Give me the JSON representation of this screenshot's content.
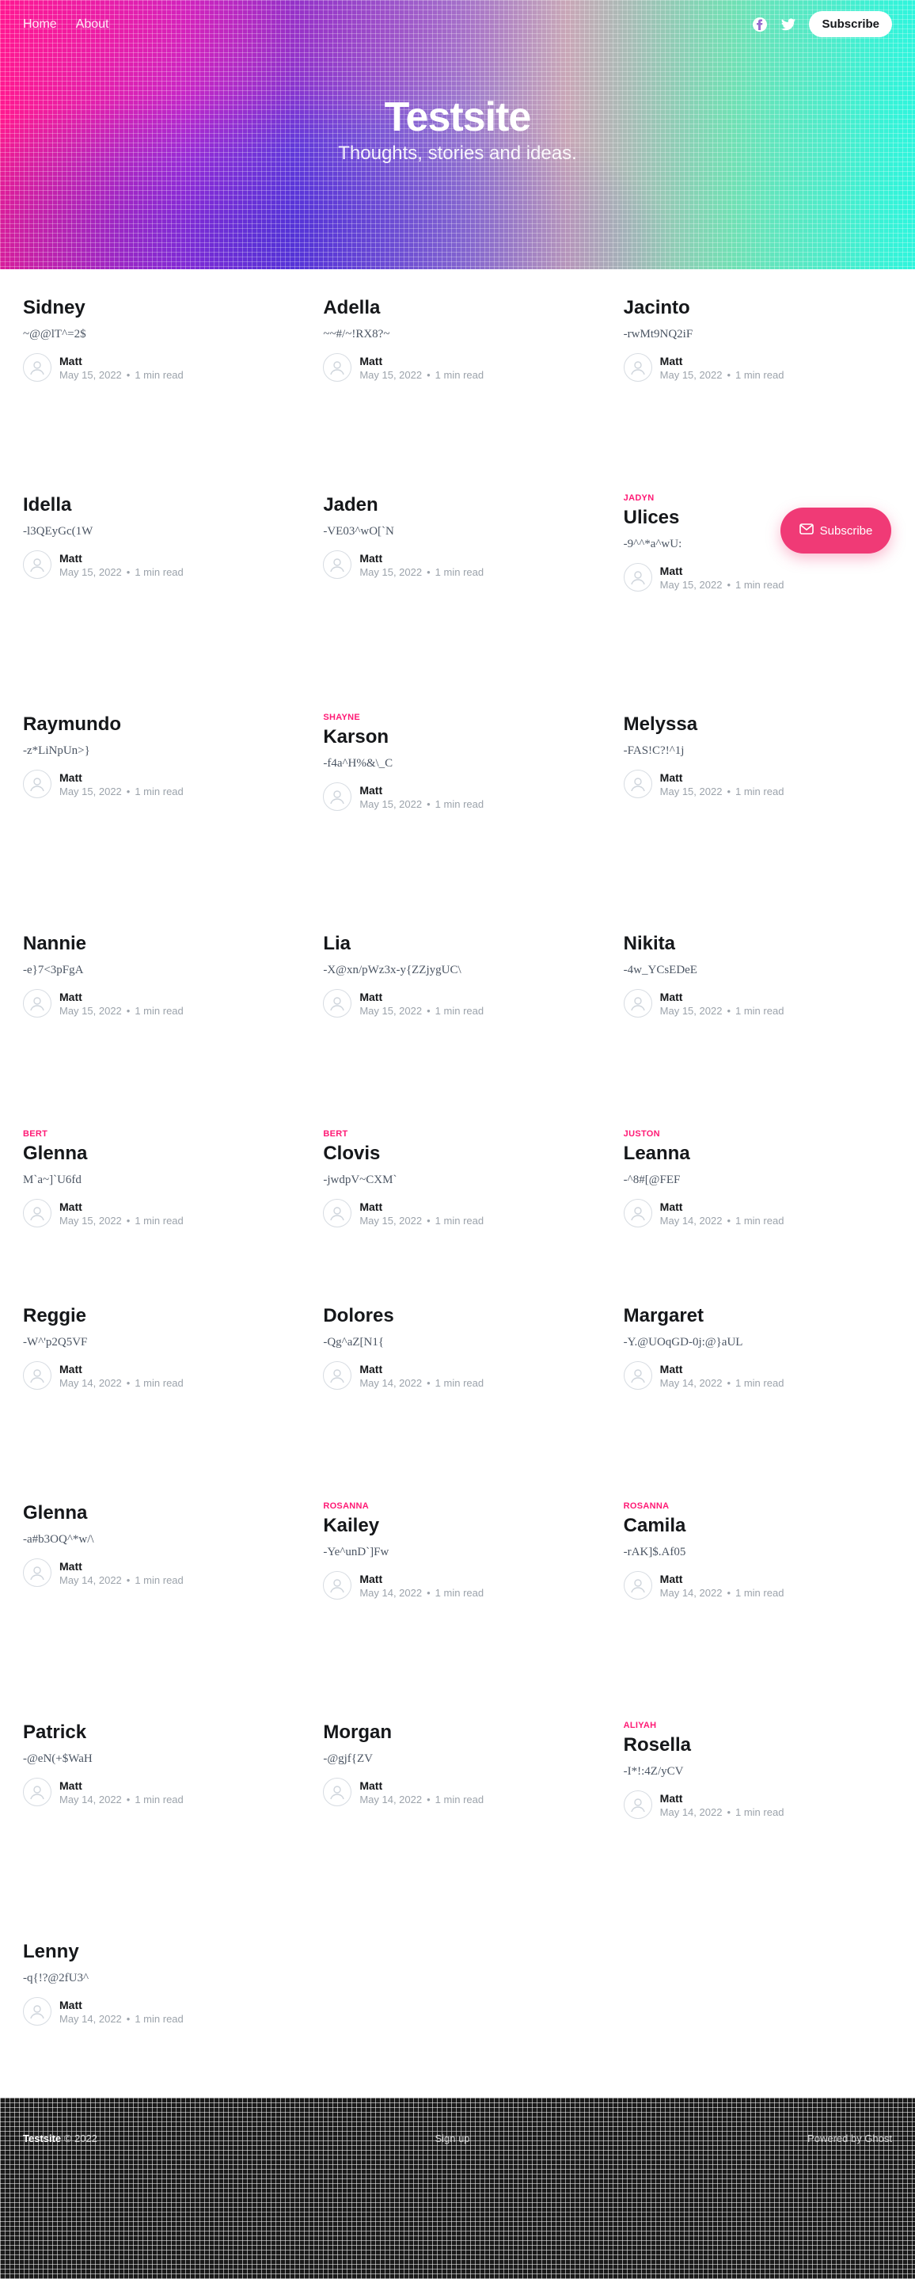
{
  "nav": {
    "links": [
      "Home",
      "About"
    ],
    "subscribe_label": "Subscribe"
  },
  "header": {
    "title": "Testsite",
    "description": "Thoughts, stories and ideas."
  },
  "posts": [
    {
      "tag": "",
      "title": "Sidney",
      "excerpt": "~@@lT^=2$",
      "author": "Matt",
      "date": "May 15, 2022",
      "read": "1 min read"
    },
    {
      "tag": "",
      "title": "Adella",
      "excerpt": "~~#/~!RX8?~",
      "author": "Matt",
      "date": "May 15, 2022",
      "read": "1 min read"
    },
    {
      "tag": "",
      "title": "Jacinto",
      "excerpt": "-rwMt9NQ2iF",
      "author": "Matt",
      "date": "May 15, 2022",
      "read": "1 min read"
    },
    {
      "tag": "",
      "title": "Idella",
      "excerpt": "-l3QEyGc(1W",
      "author": "Matt",
      "date": "May 15, 2022",
      "read": "1 min read"
    },
    {
      "tag": "",
      "title": "Jaden",
      "excerpt": "-VE03^wO[`N",
      "author": "Matt",
      "date": "May 15, 2022",
      "read": "1 min read"
    },
    {
      "tag": "Jadyn",
      "title": "Ulices",
      "excerpt": "-9^^*a^wU:",
      "author": "Matt",
      "date": "May 15, 2022",
      "read": "1 min read"
    },
    {
      "tag": "",
      "title": "Raymundo",
      "excerpt": "-z*LiNpUn>}",
      "author": "Matt",
      "date": "May 15, 2022",
      "read": "1 min read"
    },
    {
      "tag": "Shayne",
      "title": "Karson",
      "excerpt": "-f4a^H%&\\_C",
      "author": "Matt",
      "date": "May 15, 2022",
      "read": "1 min read"
    },
    {
      "tag": "",
      "title": "Melyssa",
      "excerpt": "-FAS!C?!^1j",
      "author": "Matt",
      "date": "May 15, 2022",
      "read": "1 min read"
    },
    {
      "tag": "",
      "title": "Nannie",
      "excerpt": "-e}7<3pFgA",
      "author": "Matt",
      "date": "May 15, 2022",
      "read": "1 min read"
    },
    {
      "tag": "",
      "title": "Lia",
      "excerpt": "-X@xn/pWz3x-y{ZZjygUC\\",
      "author": "Matt",
      "date": "May 15, 2022",
      "read": "1 min read"
    },
    {
      "tag": "",
      "title": "Nikita",
      "excerpt": "-4w_YCsEDeE",
      "author": "Matt",
      "date": "May 15, 2022",
      "read": "1 min read"
    },
    {
      "tag": "Bert",
      "title": "Glenna",
      "excerpt": "M`a~]`U6fd",
      "author": "Matt",
      "date": "May 15, 2022",
      "read": "1 min read"
    },
    {
      "tag": "Bert",
      "title": "Clovis",
      "excerpt": "-jwdpV~CXM`",
      "author": "Matt",
      "date": "May 15, 2022",
      "read": "1 min read"
    },
    {
      "tag": "Juston",
      "title": "Leanna",
      "excerpt": "-^8#[@FEF",
      "author": "Matt",
      "date": "May 14, 2022",
      "read": "1 min read"
    },
    {
      "tag": "",
      "title": "Reggie",
      "excerpt": "-W^'p2Q5VF",
      "author": "Matt",
      "date": "May 14, 2022",
      "read": "1 min read"
    },
    {
      "tag": "",
      "title": "Dolores",
      "excerpt": "-Qg^aZ[N1{",
      "author": "Matt",
      "date": "May 14, 2022",
      "read": "1 min read"
    },
    {
      "tag": "",
      "title": "Margaret",
      "excerpt": "-Y.@UOqGD-0j:@}aUL",
      "author": "Matt",
      "date": "May 14, 2022",
      "read": "1 min read"
    },
    {
      "tag": "",
      "title": "Glenna",
      "excerpt": "-a#b3OQ^*w/\\",
      "author": "Matt",
      "date": "May 14, 2022",
      "read": "1 min read"
    },
    {
      "tag": "Rosanna",
      "title": "Kailey",
      "excerpt": "-Ye^unD`]Fw",
      "author": "Matt",
      "date": "May 14, 2022",
      "read": "1 min read"
    },
    {
      "tag": "Rosanna",
      "title": "Camila",
      "excerpt": "-rAK]$.Af05",
      "author": "Matt",
      "date": "May 14, 2022",
      "read": "1 min read"
    },
    {
      "tag": "",
      "title": "Patrick",
      "excerpt": "-@eN(+$WaH",
      "author": "Matt",
      "date": "May 14, 2022",
      "read": "1 min read"
    },
    {
      "tag": "",
      "title": "Morgan",
      "excerpt": "-@gjf{ZV",
      "author": "Matt",
      "date": "May 14, 2022",
      "read": "1 min read"
    },
    {
      "tag": "Aliyah",
      "title": "Rosella",
      "excerpt": "-I*!:4Z/yCV",
      "author": "Matt",
      "date": "May 14, 2022",
      "read": "1 min read"
    },
    {
      "tag": "",
      "title": "Lenny",
      "excerpt": "-q{!?@2fU3^",
      "author": "Matt",
      "date": "May 14, 2022",
      "read": "1 min read"
    }
  ],
  "floating": {
    "subscribe_label": "Subscribe"
  },
  "footer": {
    "site_name": "Testsite",
    "copyright": "© 2022",
    "center_link": "Sign up",
    "powered_by": "Powered by Ghost"
  },
  "colors": {
    "accent": "#ff1a75",
    "floating_button": "#f03a76",
    "footer_bg": "#1a1a1a"
  },
  "icons": {
    "social": [
      "facebook-icon",
      "twitter-icon"
    ],
    "avatar": "user-avatar-icon",
    "subscribe": "mail-icon"
  }
}
